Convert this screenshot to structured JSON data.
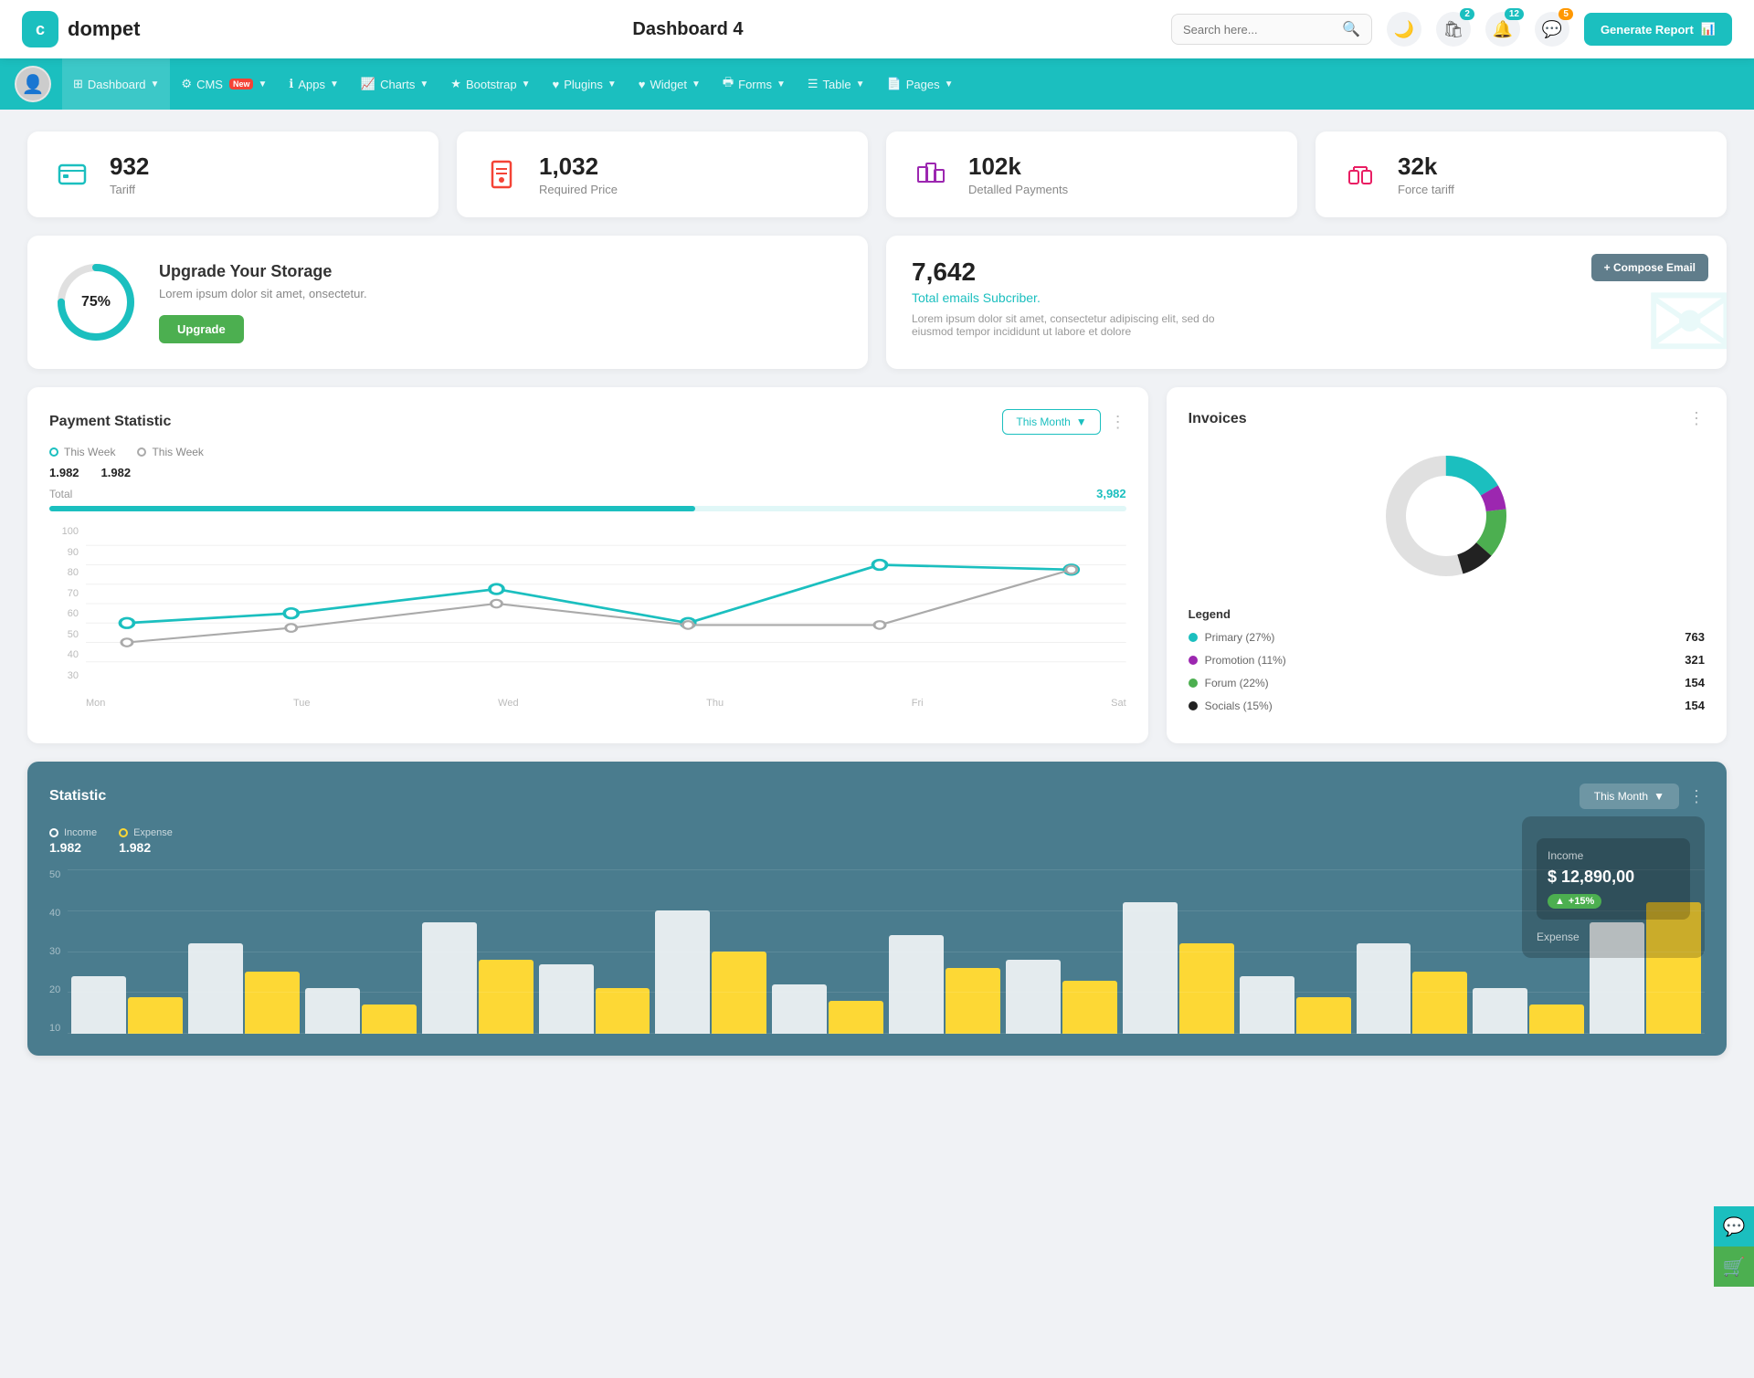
{
  "header": {
    "logo_icon": "💼",
    "logo_text": "dompet",
    "page_title": "Dashboard 4",
    "search_placeholder": "Search here...",
    "generate_btn": "Generate Report",
    "notifications": [
      {
        "icon": "🛍",
        "badge": "2",
        "badge_color": "teal"
      },
      {
        "icon": "🔔",
        "badge": "12",
        "badge_color": "teal"
      },
      {
        "icon": "💬",
        "badge": "5",
        "badge_color": "orange"
      }
    ]
  },
  "nav": {
    "items": [
      {
        "label": "Dashboard",
        "has_arrow": true,
        "active": true
      },
      {
        "label": "CMS",
        "has_arrow": true,
        "has_new": true
      },
      {
        "label": "Apps",
        "has_arrow": true
      },
      {
        "label": "Charts",
        "has_arrow": true
      },
      {
        "label": "Bootstrap",
        "has_arrow": true
      },
      {
        "label": "Plugins",
        "has_arrow": true
      },
      {
        "label": "Widget",
        "has_arrow": true
      },
      {
        "label": "Forms",
        "has_arrow": true
      },
      {
        "label": "Table",
        "has_arrow": true
      },
      {
        "label": "Pages",
        "has_arrow": true
      }
    ]
  },
  "stat_cards": [
    {
      "value": "932",
      "label": "Tariff",
      "icon_type": "teal"
    },
    {
      "value": "1,032",
      "label": "Required Price",
      "icon_type": "red"
    },
    {
      "value": "102k",
      "label": "Detalled Payments",
      "icon_type": "purple"
    },
    {
      "value": "32k",
      "label": "Force tariff",
      "icon_type": "pink"
    }
  ],
  "storage": {
    "percent": 75,
    "title": "Upgrade Your Storage",
    "desc": "Lorem ipsum dolor sit amet, onsectetur.",
    "btn_label": "Upgrade"
  },
  "email": {
    "count": "7,642",
    "subtitle": "Total emails Subcriber.",
    "desc": "Lorem ipsum dolor sit amet, consectetur adipiscing elit, sed do eiusmod tempor incididunt ut labore et dolore",
    "compose_btn": "+ Compose Email"
  },
  "payment": {
    "title": "Payment Statistic",
    "this_month_label": "This Month",
    "legend": [
      {
        "label": "This Week",
        "value": "1.982",
        "color": "#1BBFBF"
      },
      {
        "label": "This Week",
        "value": "1.982",
        "color": "#aaa"
      }
    ],
    "total_label": "Total",
    "total_value": "3,982",
    "progress_pct": 60,
    "y_labels": [
      "100",
      "90",
      "80",
      "70",
      "60",
      "50",
      "40",
      "30"
    ],
    "x_labels": [
      "Mon",
      "Tue",
      "Wed",
      "Thu",
      "Fri",
      "Sat"
    ],
    "line1_points": "60,40 170,50 310,35 450,60 580,90 720,88",
    "line2_points": "60,80 170,65 310,40 450,62 580,63 720,88"
  },
  "invoices": {
    "title": "Invoices",
    "donut": {
      "segments": [
        {
          "color": "#1BBFBF",
          "pct": 27,
          "offset": 0
        },
        {
          "color": "#9c27b0",
          "pct": 11,
          "offset": 27
        },
        {
          "color": "#4caf50",
          "pct": 22,
          "offset": 38
        },
        {
          "color": "#222",
          "pct": 15,
          "offset": 60
        },
        {
          "color": "#e0e0e0",
          "pct": 25,
          "offset": 75
        }
      ]
    },
    "legend_title": "Legend",
    "legend": [
      {
        "label": "Primary (27%)",
        "color": "#1BBFBF",
        "count": "763"
      },
      {
        "label": "Promotion (11%)",
        "color": "#9c27b0",
        "count": "321"
      },
      {
        "label": "Forum (22%)",
        "color": "#4caf50",
        "count": "154"
      },
      {
        "label": "Socials (15%)",
        "color": "#222",
        "count": "154"
      }
    ]
  },
  "statistic": {
    "title": "Statistic",
    "this_month_label": "This Month",
    "y_labels": [
      "50",
      "40",
      "30",
      "20",
      "10"
    ],
    "income": {
      "label": "Income",
      "value": "1.982",
      "dot_color": "#fff"
    },
    "expense": {
      "label": "Expense",
      "value": "1.982",
      "dot_color": "#fdd835"
    },
    "income_box": {
      "label": "Income",
      "value": "$ 12,890,00",
      "change": "+15%"
    },
    "bars": [
      {
        "white": 35,
        "yellow": 22
      },
      {
        "white": 55,
        "yellow": 38
      },
      {
        "white": 28,
        "yellow": 18
      },
      {
        "white": 68,
        "yellow": 45
      },
      {
        "white": 42,
        "yellow": 28
      },
      {
        "white": 75,
        "yellow": 50
      },
      {
        "white": 30,
        "yellow": 20
      },
      {
        "white": 60,
        "yellow": 40
      },
      {
        "white": 45,
        "yellow": 32
      },
      {
        "white": 80,
        "yellow": 55
      },
      {
        "white": 35,
        "yellow": 22
      },
      {
        "white": 55,
        "yellow": 38
      },
      {
        "white": 28,
        "yellow": 18
      },
      {
        "white": 68,
        "yellow": 80
      }
    ]
  }
}
